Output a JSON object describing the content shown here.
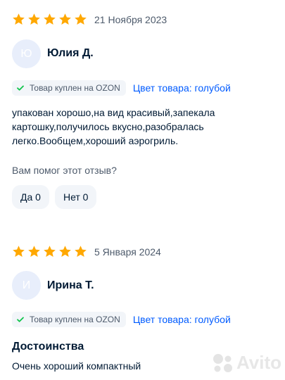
{
  "reviews": [
    {
      "rating": 5,
      "date": "21 Ноября 2023",
      "author_initial": "Ю",
      "author": "Юлия Д.",
      "purchased_label": "Товар куплен на OZON",
      "color_label": "Цвет товара: голубой",
      "text": "упакован хорошо,на вид красивый,запекала картошку,получилось вкусно,разобралась легко.Вообщем,хороший аэрогриль.",
      "helpful_question": "Вам помог этот отзыв?",
      "yes_label": "Да 0",
      "no_label": "Нет 0"
    },
    {
      "rating": 5,
      "date": "5 Января 2024",
      "author_initial": "И",
      "author": "Ирина Т.",
      "purchased_label": "Товар куплен на OZON",
      "color_label": "Цвет товара: голубой",
      "pros_title": "Достоинства",
      "pros_text": "Очень хороший компактный"
    }
  ],
  "watermark": "Avito",
  "colors": {
    "star": "#ffa800",
    "accent": "#005bff",
    "check": "#10c44c",
    "muted": "#4d5a6b",
    "chip": "#f2f5f9"
  },
  "icons": {
    "star": "star-icon",
    "check": "check-icon",
    "watermark": "avito-logo-icon"
  }
}
